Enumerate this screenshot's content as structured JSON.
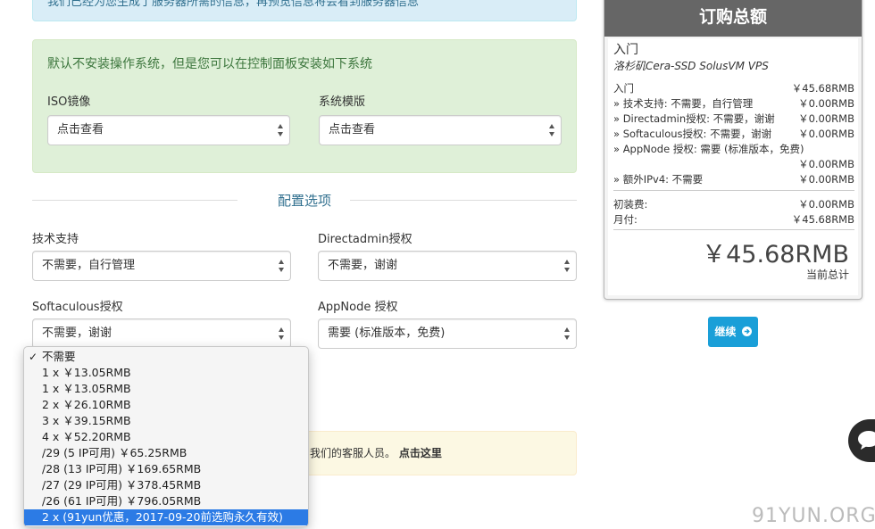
{
  "top_alert": "我们已经为您生成了服务器所需的信息，再预览信息将会看到服务器信息",
  "os_panel": {
    "message": "默认不安装操作系统，但是您可以在控制面板安装如下系统",
    "iso_label": "ISO镜像",
    "iso_value": "点击查看",
    "template_label": "系统模版",
    "template_value": "点击查看"
  },
  "config": {
    "heading": "配置选项",
    "support_label": "技术支持",
    "support_value": "不需要，自行管理",
    "directadmin_label": "Directadmin授权",
    "directadmin_value": "不需要，谢谢",
    "softaculous_label": "Softaculous授权",
    "softaculous_value": "不需要，谢谢",
    "appnode_label": "AppNode 授权",
    "appnode_value": "需要 (标准版本，免费)"
  },
  "warning": {
    "text": "我们的客服人员。",
    "link": "点击这里"
  },
  "dropdown": {
    "items": [
      "不需要",
      "1 x ￥13.05RMB",
      "1 x ￥13.05RMB",
      "2 x ￥26.10RMB",
      "3 x ￥39.15RMB",
      "4 x ￥52.20RMB",
      "/29 (5 IP可用) ￥65.25RMB",
      "/28 (13 IP可用) ￥169.65RMB",
      "/27 (29 IP可用) ￥378.45RMB",
      "/26 (61 IP可用) ￥796.05RMB",
      "2 x (91yun优惠，2017-09-20前选购永久有效)"
    ],
    "checked_index": 0,
    "selected_index": 10
  },
  "summary": {
    "title": "订购总额",
    "product_name": "入门",
    "product_desc": "洛杉矶Cera-SSD SolusVM VPS",
    "lines": [
      {
        "label": "入门",
        "price": "￥45.68RMB"
      },
      {
        "label": "» 技术支持: 不需要，自行管理",
        "price": "￥0.00RMB"
      },
      {
        "label": "» Directadmin授权: 不需要，谢谢",
        "price": "￥0.00RMB"
      },
      {
        "label": "» Softaculous授权: 不需要，谢谢",
        "price": "￥0.00RMB"
      },
      {
        "label": "» AppNode 授权: 需要 (标准版本，免费)",
        "price": ""
      },
      {
        "label": "",
        "price": "￥0.00RMB"
      },
      {
        "label": "» 额外IPv4: 不需要",
        "price": "￥0.00RMB"
      }
    ],
    "setup_label": "初装费:",
    "setup_price": "￥0.00RMB",
    "monthly_label": "月付:",
    "monthly_price": "￥45.68RMB",
    "total": "￥45.68RMB",
    "total_label": "当前总计"
  },
  "continue_label": "继续",
  "watermark": "91YUN.ORG",
  "colors": {
    "accent": "#31708f",
    "button": "#1a9fd8",
    "selected": "#2c7be5"
  }
}
